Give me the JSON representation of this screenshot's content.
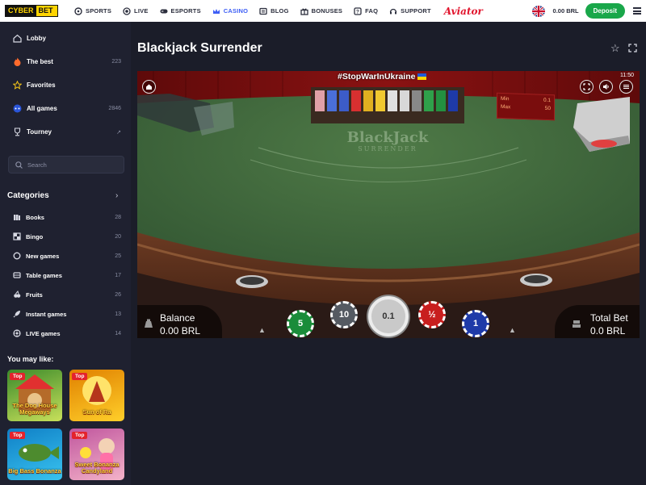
{
  "brand": {
    "logo_left": "CYBER",
    "logo_right": "BET"
  },
  "nav": [
    {
      "label": "SPORTS",
      "icon": "soccer-ball-icon"
    },
    {
      "label": "LIVE",
      "icon": "live-icon"
    },
    {
      "label": "ESPORTS",
      "icon": "gamepad-icon"
    },
    {
      "label": "CASINO",
      "icon": "crown-icon",
      "active": true
    },
    {
      "label": "BLOG",
      "icon": "blog-icon"
    },
    {
      "label": "BONUSES",
      "icon": "gift-icon"
    },
    {
      "label": "FAQ",
      "icon": "faq-icon"
    },
    {
      "label": "SUPPORT",
      "icon": "headset-icon"
    }
  ],
  "aviator": "Aviator",
  "account": {
    "balance": "0.00 BRL",
    "deposit_label": "Deposit"
  },
  "sidebar": {
    "items": [
      {
        "label": "Lobby",
        "icon": "home-icon",
        "count": ""
      },
      {
        "label": "The best",
        "icon": "fire-icon",
        "count": "223"
      },
      {
        "label": "Favorites",
        "icon": "star-icon",
        "count": ""
      },
      {
        "label": "All games",
        "icon": "all-games-icon",
        "count": "2846"
      },
      {
        "label": "Tourney",
        "icon": "trophy-icon",
        "count": ""
      }
    ],
    "search_placeholder": "Search",
    "categories_title": "Categories",
    "categories": [
      {
        "label": "Books",
        "icon": "books-icon",
        "count": "28"
      },
      {
        "label": "Bingo",
        "icon": "bingo-icon",
        "count": "20"
      },
      {
        "label": "New games",
        "icon": "new-icon",
        "count": "25"
      },
      {
        "label": "Table games",
        "icon": "table-icon",
        "count": "17"
      },
      {
        "label": "Fruits",
        "icon": "fruit-icon",
        "count": "26"
      },
      {
        "label": "Instant games",
        "icon": "rocket-icon",
        "count": "13"
      },
      {
        "label": "LIVE games",
        "icon": "live-games-icon",
        "count": "14"
      }
    ],
    "you_may_like": "You may like:",
    "recommended": [
      {
        "badge": "Top",
        "name": "The Dog House Megaways",
        "colors": [
          "#3b8a2b",
          "#c8e05a"
        ]
      },
      {
        "badge": "Top",
        "name": "Sun of Ra",
        "colors": [
          "#e08000",
          "#ffcf2a"
        ]
      },
      {
        "badge": "Top",
        "name": "Big Bass Bonanza",
        "colors": [
          "#0f7fc6",
          "#39c3ef"
        ]
      },
      {
        "badge": "Top",
        "name": "Sweet Bonanza Candyland",
        "colors": [
          "#c0569e",
          "#f4b3c9"
        ]
      }
    ]
  },
  "game": {
    "title": "Blackjack Surrender",
    "banner": "#StopWarInUkraine",
    "time": "11:50",
    "table_brand": "BlackJack",
    "table_variant": "SURRENDER",
    "limits": {
      "min_label": "Min",
      "min_value": "0.1",
      "max_label": "Max",
      "max_value": "50"
    },
    "balance_label": "Balance",
    "balance_value": "0.00 BRL",
    "total_bet_label": "Total Bet",
    "total_bet_value": "0.0 BRL",
    "chips": [
      "5",
      "10",
      "0.1",
      "½",
      "1"
    ],
    "chip_colors": [
      "#1a8c3a",
      "#555a62",
      "#c9c9c9",
      "#c81e1e",
      "#1e3aa8"
    ]
  }
}
